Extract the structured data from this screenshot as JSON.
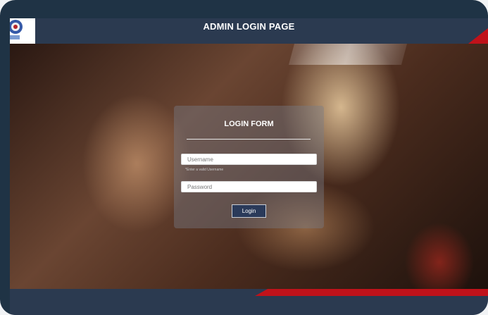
{
  "header": {
    "title": "ADMIN LOGIN PAGE",
    "logo_icon": "emblem-logo-icon"
  },
  "login_form": {
    "title": "LOGIN FORM",
    "username_placeholder": "Username",
    "username_hint": "*Enter a valid Username",
    "password_placeholder": "Password",
    "login_button": "Login"
  },
  "colors": {
    "header": "#2b3a50",
    "accent": "#c0121a",
    "button": "#2a3a5a"
  }
}
